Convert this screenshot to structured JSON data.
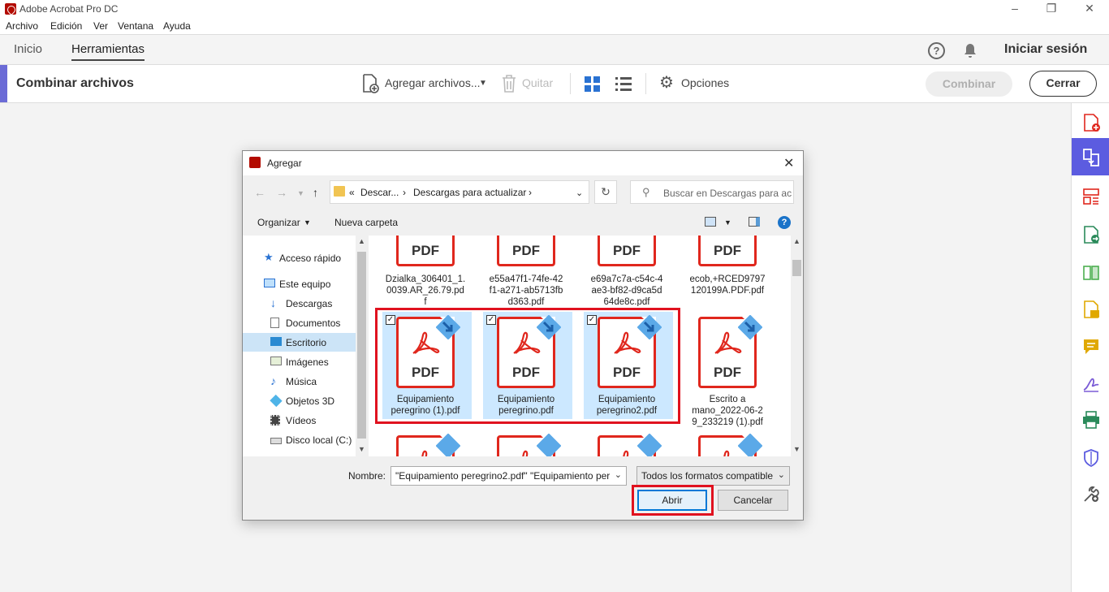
{
  "window": {
    "title": "Adobe Acrobat Pro DC"
  },
  "menu": [
    "Archivo",
    "Edición",
    "Ver",
    "Ventana",
    "Ayuda"
  ],
  "tabs": {
    "home": "Inicio",
    "tools": "Herramientas"
  },
  "header": {
    "help": "?",
    "signin": "Iniciar sesión"
  },
  "toolbar": {
    "title": "Combinar archivos",
    "add_files": "Agregar archivos...",
    "remove": "Quitar",
    "options": "Opciones",
    "combine": "Combinar",
    "close": "Cerrar"
  },
  "dialog": {
    "title": "Agregar",
    "breadcrumb": {
      "prefix": "«",
      "part1": "Descar...",
      "sep1": "›",
      "part2": "Descargas para actualizar",
      "sep2": "›"
    },
    "search_placeholder": "Buscar en Descargas para ac...",
    "organize": "Organizar",
    "new_folder": "Nueva carpeta",
    "help": "?",
    "nav": [
      "Acceso rápido",
      "Este equipo",
      "Descargas",
      "Documentos",
      "Escritorio",
      "Imágenes",
      "Música",
      "Objetos 3D",
      "Vídeos",
      "Disco local (C:)"
    ],
    "files_row1": [
      "Dzialka_306401_1.\n0039.AR_26.79.pd\nf",
      "e55a47f1-74fe-42\nf1-a271-ab5713fb\nd363.pdf",
      "e69a7c7a-c54c-4\nae3-bf82-d9ca5d\n64de8c.pdf",
      "ecob,+RCED9797\n120199A.PDF.pdf"
    ],
    "files_row2": [
      "Equipamiento\nperegrino (1).pdf",
      "Equipamiento\nperegrino.pdf",
      "Equipamiento\nperegrino2.pdf",
      "Escrito a\nmano_2022-06-2\n9_233219 (1).pdf"
    ],
    "pdf_label": "PDF",
    "name_label": "Nombre:",
    "name_value": "\"Equipamiento peregrino2.pdf\" \"Equipamiento per",
    "type_value": "Todos los formatos compatible",
    "open": "Abrir",
    "cancel": "Cancelar"
  },
  "colors": {
    "accent": "#6b6bd6",
    "pdf_red": "#e0271d",
    "highlight": "#e0121f",
    "selection": "#cce8ff"
  }
}
